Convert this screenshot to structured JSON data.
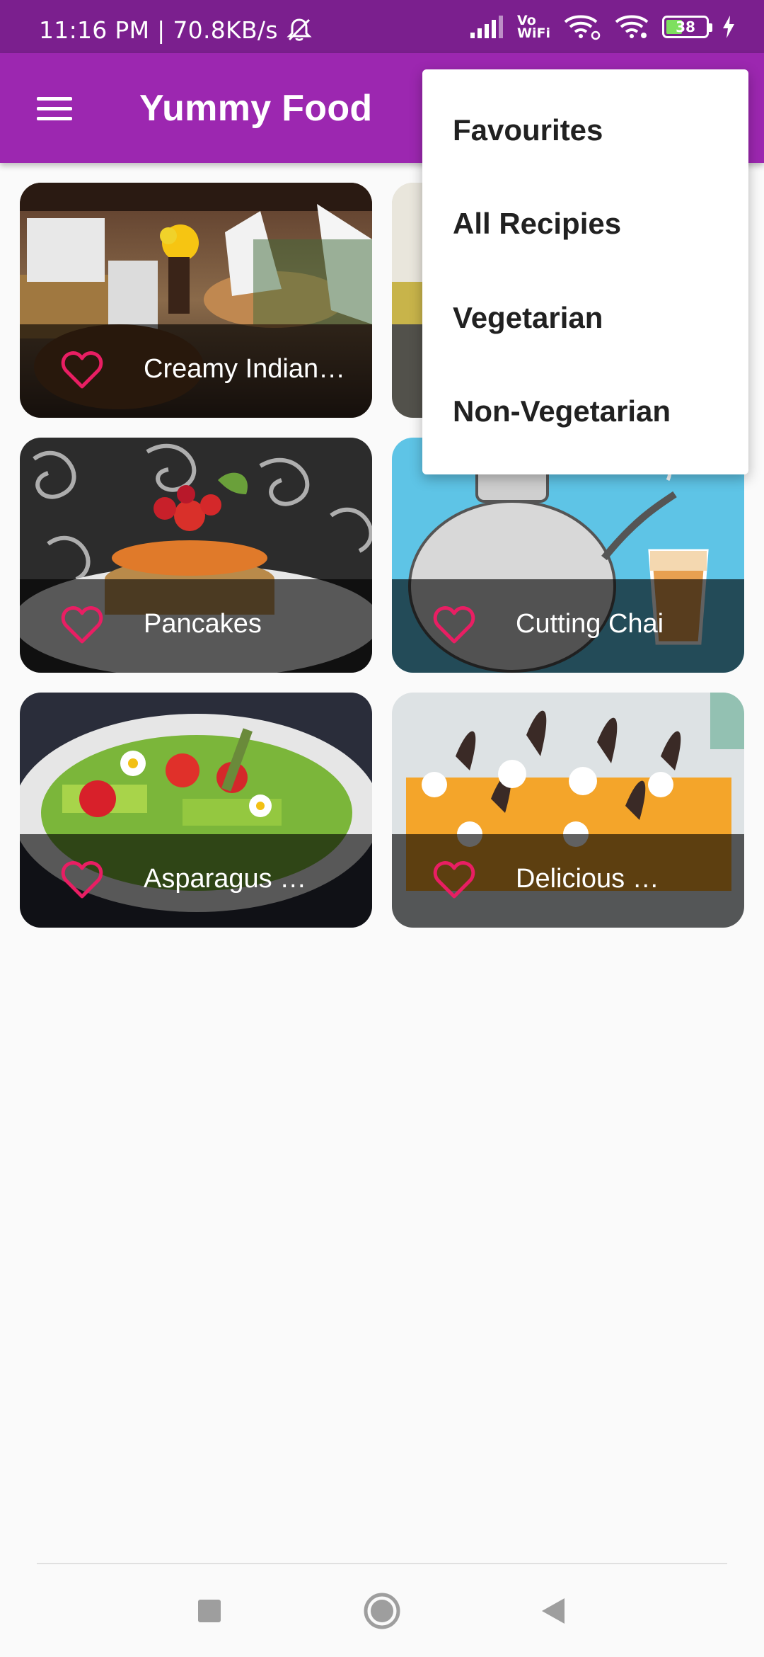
{
  "status_bar": {
    "time_speed": "11:16 PM | 70.8KB/s",
    "network_label_top": "Vo",
    "network_label_bottom": "WiFi",
    "battery": "38"
  },
  "app_bar": {
    "title": "Yummy Food"
  },
  "recipes": [
    {
      "title": "Creamy Indian…",
      "favourite": false
    },
    {
      "title": "",
      "favourite": false
    },
    {
      "title": "Pancakes",
      "favourite": false
    },
    {
      "title": "Cutting Chai",
      "favourite": false
    },
    {
      "title": "Asparagus …",
      "favourite": false
    },
    {
      "title": "Delicious …",
      "favourite": false
    }
  ],
  "filter_menu": {
    "items": [
      "Favourites",
      "All Recipies",
      "Vegetarian",
      "Non-Vegetarian"
    ]
  },
  "colors": {
    "status_bar": "#7b1f8e",
    "app_bar": "#9c27b0",
    "heart": "#e91e63"
  },
  "icons": {
    "menu": "menu-icon",
    "heart": "heart-outline-icon",
    "nav_recents": "square-icon",
    "nav_home": "circle-icon",
    "nav_back": "triangle-back-icon"
  }
}
